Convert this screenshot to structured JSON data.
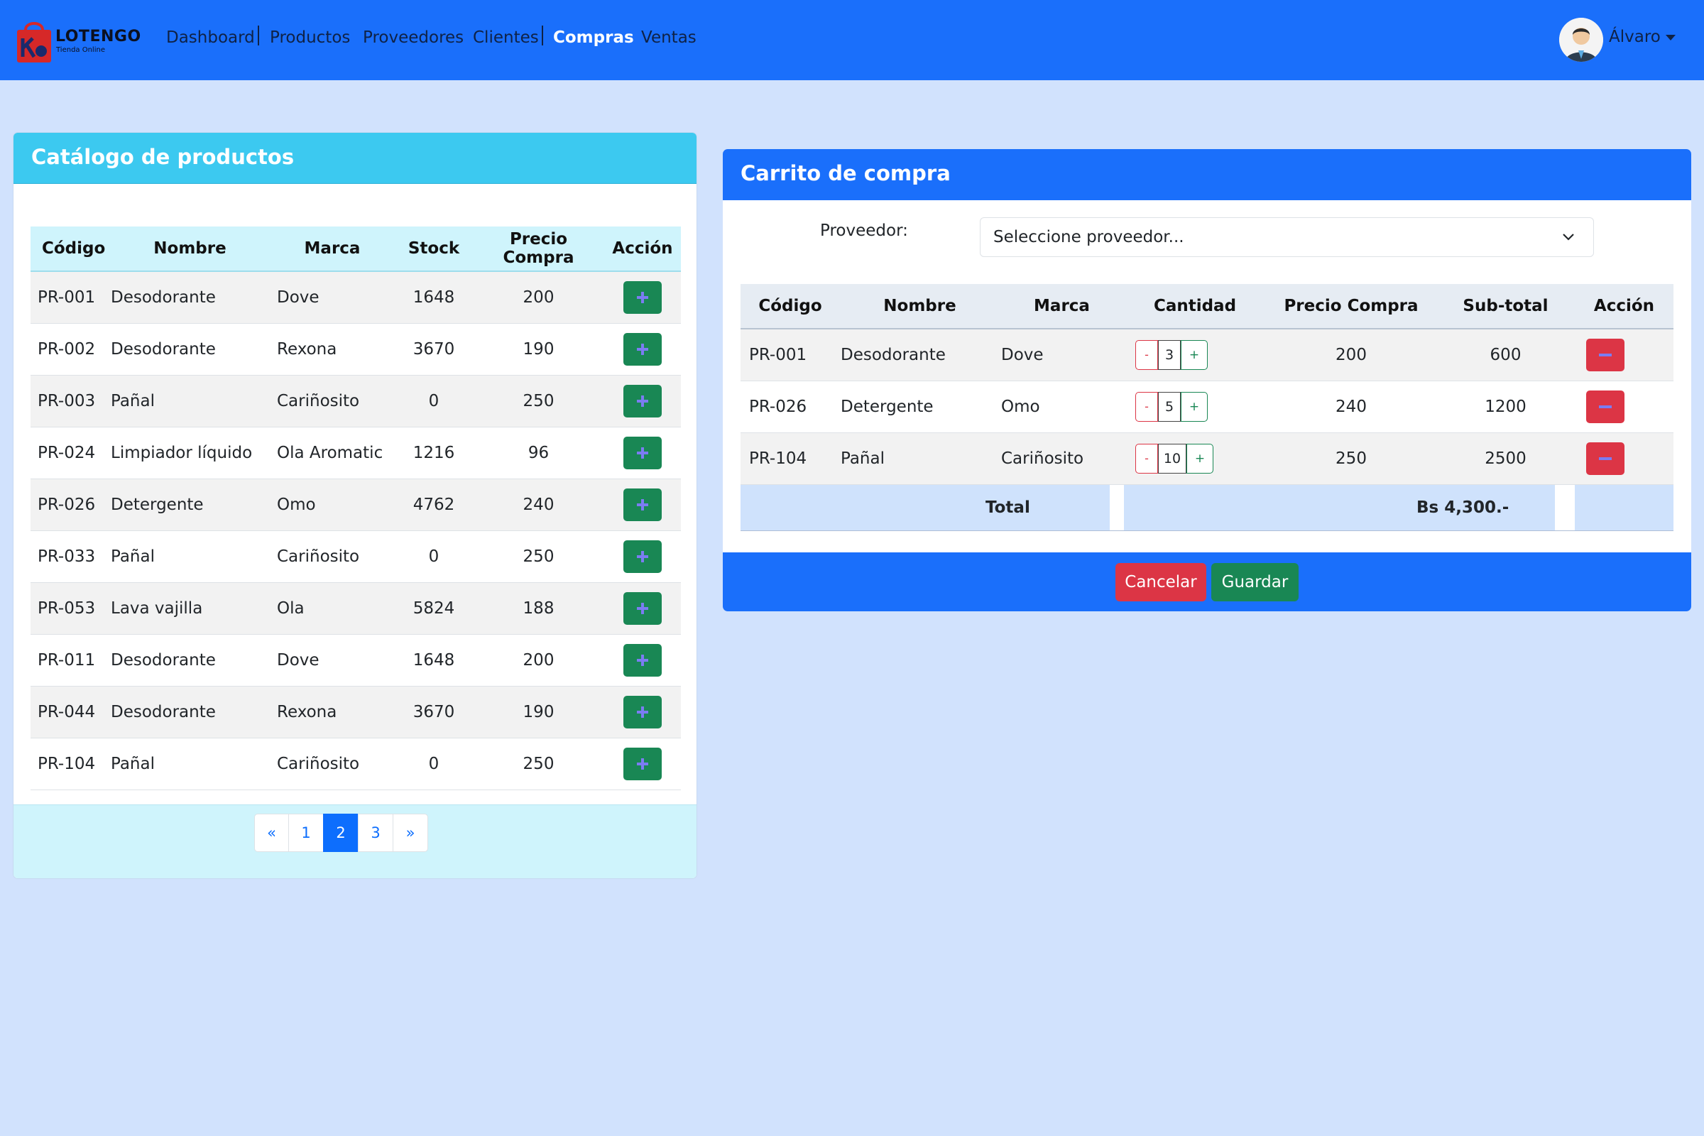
{
  "navbar": {
    "brand_name": "LOTENGO",
    "brand_sub": "Tienda Online",
    "links": [
      "Dashboard",
      "Productos",
      "Proveedores",
      "Clientes",
      "Compras",
      "Ventas"
    ],
    "active": "Compras",
    "user_name": "Álvaro",
    "color": "#1a6ffb"
  },
  "catalog": {
    "title": "Catálogo de productos",
    "columns": [
      "Código",
      "Nombre",
      "Marca",
      "Stock",
      "Precio Compra",
      "Acción"
    ],
    "rows": [
      {
        "codigo": "PR-001",
        "nombre": "Desodorante",
        "marca": "Dove",
        "stock": "1648",
        "precio": "200"
      },
      {
        "codigo": "PR-002",
        "nombre": "Desodorante",
        "marca": "Rexona",
        "stock": "3670",
        "precio": "190"
      },
      {
        "codigo": "PR-003",
        "nombre": "Pañal",
        "marca": "Cariñosito",
        "stock": "0",
        "precio": "250"
      },
      {
        "codigo": "PR-024",
        "nombre": "Limpiador líquido",
        "marca": "Ola Aromatic",
        "stock": "1216",
        "precio": "96"
      },
      {
        "codigo": "PR-026",
        "nombre": "Detergente",
        "marca": "Omo",
        "stock": "4762",
        "precio": "240"
      },
      {
        "codigo": "PR-033",
        "nombre": "Pañal",
        "marca": "Cariñosito",
        "stock": "0",
        "precio": "250"
      },
      {
        "codigo": "PR-053",
        "nombre": "Lava vajilla",
        "marca": "Ola",
        "stock": "5824",
        "precio": "188"
      },
      {
        "codigo": "PR-011",
        "nombre": "Desodorante",
        "marca": "Dove",
        "stock": "1648",
        "precio": "200"
      },
      {
        "codigo": "PR-044",
        "nombre": "Desodorante",
        "marca": "Rexona",
        "stock": "3670",
        "precio": "190"
      },
      {
        "codigo": "PR-104",
        "nombre": "Pañal",
        "marca": "Cariñosito",
        "stock": "0",
        "precio": "250"
      }
    ],
    "pagination": {
      "prev": "«",
      "pages": [
        "1",
        "2",
        "3"
      ],
      "current": "2",
      "next": "»"
    }
  },
  "cart": {
    "title": "Carrito de compra",
    "proveedor_label": "Proveedor:",
    "proveedor_placeholder": "Seleccione proveedor...",
    "columns": [
      "Código",
      "Nombre",
      "Marca",
      "Cantidad",
      "Precio Compra",
      "Sub-total",
      "Acción"
    ],
    "rows": [
      {
        "codigo": "PR-001",
        "nombre": "Desodorante",
        "marca": "Dove",
        "cantidad": "3",
        "precio": "200",
        "subtotal": "600"
      },
      {
        "codigo": "PR-026",
        "nombre": "Detergente",
        "marca": "Omo",
        "cantidad": "5",
        "precio": "240",
        "subtotal": "1200"
      },
      {
        "codigo": "PR-104",
        "nombre": "Pañal",
        "marca": "Cariñosito",
        "cantidad": "10",
        "precio": "250",
        "subtotal": "2500"
      }
    ],
    "qty_minus": "-",
    "qty_plus": "+",
    "total_label": "Total",
    "total_value": "Bs 4,300.-",
    "cancel_label": "Cancelar",
    "save_label": "Guardar"
  }
}
